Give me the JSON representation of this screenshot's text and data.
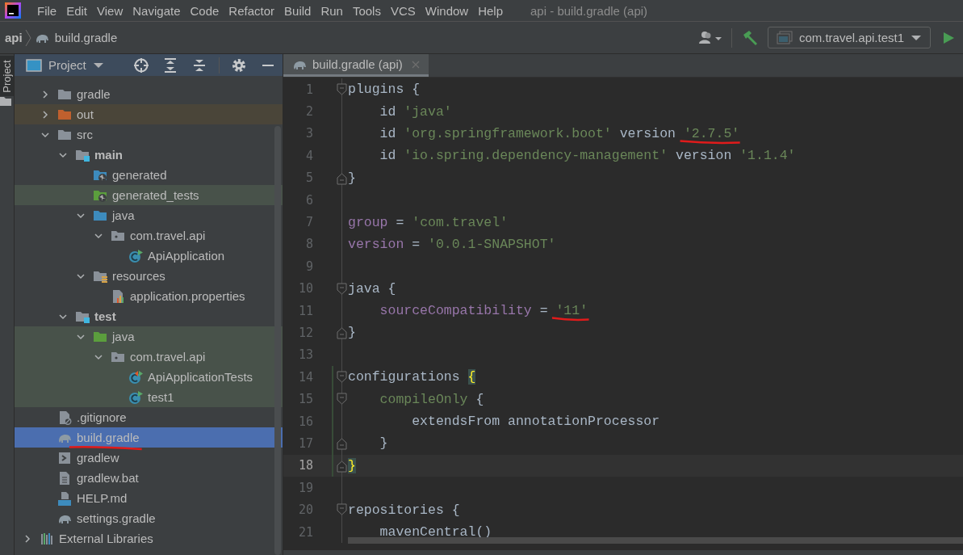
{
  "menu": {
    "items": [
      "File",
      "Edit",
      "View",
      "Navigate",
      "Code",
      "Refactor",
      "Build",
      "Run",
      "Tools",
      "VCS",
      "Window",
      "Help"
    ],
    "title": "api - build.gradle (api)"
  },
  "breadcrumbs": [
    {
      "label": "api",
      "kind": "project"
    },
    {
      "label": "build.gradle",
      "kind": "gradle"
    }
  ],
  "run_config": {
    "label": "com.travel.api.test1"
  },
  "side_strip": {
    "label": "Project",
    "selected": true
  },
  "project_panel": {
    "title": "Project",
    "tree": [
      {
        "label": "gradle",
        "kind": "folder",
        "expanded": false,
        "bold": false,
        "selected": false,
        "excluded": false,
        "test_source": false,
        "marked": false
      },
      {
        "label": "out",
        "kind": "excluded-folder",
        "expanded": false,
        "bold": false,
        "selected": false,
        "excluded": true,
        "test_source": false,
        "marked": false
      },
      {
        "label": "src",
        "kind": "folder",
        "expanded": true,
        "bold": false,
        "selected": false,
        "excluded": false,
        "test_source": false,
        "marked": false,
        "children": [
          {
            "label": "main",
            "kind": "module-folder",
            "bold": true,
            "expanded": true,
            "selected": false,
            "excluded": false,
            "test_source": false,
            "marked": false,
            "children": [
              {
                "label": "generated",
                "kind": "generated-source",
                "bold": false,
                "selected": false,
                "excluded": false,
                "test_source": false,
                "marked": false
              },
              {
                "label": "generated_tests",
                "kind": "generated-test",
                "bold": false,
                "selected": false,
                "excluded": false,
                "test_source": true,
                "marked": false
              },
              {
                "label": "java",
                "kind": "source-folder",
                "expanded": true,
                "bold": false,
                "selected": false,
                "excluded": false,
                "test_source": false,
                "marked": false,
                "children": [
                  {
                    "label": "com.travel.api",
                    "kind": "package",
                    "expanded": true,
                    "bold": false,
                    "selected": false,
                    "excluded": false,
                    "test_source": false,
                    "marked": false,
                    "children": [
                      {
                        "label": "ApiApplication",
                        "kind": "run-class",
                        "bold": false,
                        "selected": false,
                        "excluded": false,
                        "test_source": false,
                        "marked": false
                      }
                    ]
                  }
                ]
              },
              {
                "label": "resources",
                "kind": "resources-folder",
                "expanded": true,
                "bold": false,
                "selected": false,
                "excluded": false,
                "test_source": false,
                "marked": false,
                "children": [
                  {
                    "label": "application.properties",
                    "kind": "properties",
                    "bold": false,
                    "selected": false,
                    "excluded": false,
                    "test_source": false,
                    "marked": false
                  }
                ]
              }
            ]
          },
          {
            "label": "test",
            "kind": "module-folder",
            "bold": true,
            "expanded": true,
            "selected": false,
            "excluded": false,
            "test_source": false,
            "marked": false,
            "children": [
              {
                "label": "java",
                "kind": "test-folder",
                "expanded": true,
                "bold": false,
                "selected": false,
                "excluded": false,
                "test_source": true,
                "marked": false,
                "children": [
                  {
                    "label": "com.travel.api",
                    "kind": "package",
                    "expanded": true,
                    "bold": false,
                    "selected": false,
                    "excluded": false,
                    "test_source": true,
                    "marked": false,
                    "children": [
                      {
                        "label": "ApiApplicationTests",
                        "kind": "test-class",
                        "bold": false,
                        "selected": false,
                        "excluded": false,
                        "test_source": true,
                        "marked": false
                      },
                      {
                        "label": "test1",
                        "kind": "run-class",
                        "bold": false,
                        "selected": false,
                        "excluded": false,
                        "test_source": true,
                        "marked": false
                      }
                    ]
                  }
                ]
              }
            ]
          }
        ]
      },
      {
        "label": ".gitignore",
        "kind": "ignore-file",
        "bold": false,
        "selected": false,
        "excluded": false,
        "test_source": false,
        "marked": false
      },
      {
        "label": "build.gradle",
        "kind": "gradle",
        "bold": false,
        "selected": true,
        "excluded": false,
        "test_source": false,
        "marked": true
      },
      {
        "label": "gradlew",
        "kind": "script",
        "bold": false,
        "selected": false,
        "excluded": false,
        "test_source": false,
        "marked": false
      },
      {
        "label": "gradlew.bat",
        "kind": "text-file",
        "bold": false,
        "selected": false,
        "excluded": false,
        "test_source": false,
        "marked": false
      },
      {
        "label": "HELP.md",
        "kind": "markdown",
        "bold": false,
        "selected": false,
        "excluded": false,
        "test_source": false,
        "marked": false
      },
      {
        "label": "settings.gradle",
        "kind": "gradle",
        "bold": false,
        "selected": false,
        "excluded": false,
        "test_source": false,
        "marked": false
      },
      {
        "label": "External Libraries",
        "kind": "libraries",
        "expanded": false,
        "bold": false,
        "selected": false,
        "excluded": false,
        "test_source": false,
        "marked": false
      }
    ]
  },
  "editor": {
    "tabs": [
      {
        "label": "build.gradle (api)",
        "selected": true
      }
    ],
    "lines": [
      {
        "number": "1",
        "fold_start": true,
        "fold_end": false,
        "current": false,
        "changed": false,
        "tokens": [
          {
            "kind": "plain",
            "text": "plugins {"
          }
        ]
      },
      {
        "number": "2",
        "fold_start": false,
        "fold_end": false,
        "current": false,
        "changed": false,
        "tokens": [
          {
            "kind": "plain",
            "text": "    id "
          },
          {
            "kind": "string",
            "text": "'java'"
          }
        ]
      },
      {
        "number": "3",
        "fold_start": false,
        "fold_end": false,
        "current": false,
        "changed": false,
        "tokens": [
          {
            "kind": "plain",
            "text": "    id "
          },
          {
            "kind": "string",
            "text": "'org.springframework.boot'"
          },
          {
            "kind": "plain",
            "text": " version "
          },
          {
            "kind": "string",
            "text": "'2.7.5'",
            "marked": true
          }
        ]
      },
      {
        "number": "4",
        "fold_start": false,
        "fold_end": false,
        "current": false,
        "changed": false,
        "tokens": [
          {
            "kind": "plain",
            "text": "    id "
          },
          {
            "kind": "string",
            "text": "'io.spring.dependency-management'"
          },
          {
            "kind": "plain",
            "text": " version "
          },
          {
            "kind": "string",
            "text": "'1.1.4'"
          }
        ]
      },
      {
        "number": "5",
        "fold_start": false,
        "fold_end": true,
        "current": false,
        "changed": false,
        "tokens": [
          {
            "kind": "plain",
            "text": "}"
          }
        ]
      },
      {
        "number": "6",
        "fold_start": false,
        "fold_end": false,
        "current": false,
        "changed": false
      },
      {
        "number": "7",
        "fold_start": false,
        "fold_end": false,
        "current": false,
        "changed": false,
        "tokens": [
          {
            "kind": "field",
            "text": "group"
          },
          {
            "kind": "plain",
            "text": " = "
          },
          {
            "kind": "string",
            "text": "'com.travel'"
          }
        ]
      },
      {
        "number": "8",
        "fold_start": false,
        "fold_end": false,
        "current": false,
        "changed": false,
        "tokens": [
          {
            "kind": "field",
            "text": "version"
          },
          {
            "kind": "plain",
            "text": " = "
          },
          {
            "kind": "string",
            "text": "'0.0.1-SNAPSHOT'"
          }
        ]
      },
      {
        "number": "9",
        "fold_start": false,
        "fold_end": false,
        "current": false,
        "changed": false
      },
      {
        "number": "10",
        "fold_start": true,
        "fold_end": false,
        "current": false,
        "changed": false,
        "tokens": [
          {
            "kind": "plain",
            "text": "java {"
          }
        ]
      },
      {
        "number": "11",
        "fold_start": false,
        "fold_end": false,
        "current": false,
        "changed": false,
        "tokens": [
          {
            "kind": "field",
            "text": "    sourceCompatibility"
          },
          {
            "kind": "plain",
            "text": " = "
          },
          {
            "kind": "string",
            "text": "'11'",
            "marked": true
          }
        ]
      },
      {
        "number": "12",
        "fold_start": false,
        "fold_end": true,
        "current": false,
        "changed": false,
        "tokens": [
          {
            "kind": "plain",
            "text": "}"
          }
        ]
      },
      {
        "number": "13",
        "fold_start": false,
        "fold_end": false,
        "current": false,
        "changed": false
      },
      {
        "number": "14",
        "fold_start": true,
        "fold_end": false,
        "current": false,
        "changed": true,
        "tokens": [
          {
            "kind": "plain",
            "text": "configurations "
          },
          {
            "kind": "brace-match",
            "text": "{"
          }
        ]
      },
      {
        "number": "15",
        "fold_start": true,
        "fold_end": false,
        "current": false,
        "changed": true,
        "tokens": [
          {
            "kind": "method",
            "text": "    compileOnly"
          },
          {
            "kind": "plain",
            "text": " {"
          }
        ]
      },
      {
        "number": "16",
        "fold_start": false,
        "fold_end": false,
        "current": false,
        "changed": true,
        "tokens": [
          {
            "kind": "plain",
            "text": "        extendsFrom annotationProcessor"
          }
        ]
      },
      {
        "number": "17",
        "fold_start": false,
        "fold_end": true,
        "current": false,
        "changed": true,
        "tokens": [
          {
            "kind": "plain",
            "text": "    }"
          }
        ]
      },
      {
        "number": "18",
        "fold_start": false,
        "fold_end": true,
        "current": true,
        "changed": true,
        "tokens": [
          {
            "kind": "brace-match",
            "text": "}"
          }
        ]
      },
      {
        "number": "19",
        "fold_start": false,
        "fold_end": false,
        "current": false,
        "changed": false
      },
      {
        "number": "20",
        "fold_start": true,
        "fold_end": false,
        "current": false,
        "changed": false,
        "tokens": [
          {
            "kind": "plain",
            "text": "repositories {"
          }
        ]
      },
      {
        "number": "21",
        "fold_start": false,
        "fold_end": false,
        "current": false,
        "changed": false,
        "tokens": [
          {
            "kind": "plain",
            "text": "    mavenCentral()"
          }
        ]
      }
    ]
  }
}
